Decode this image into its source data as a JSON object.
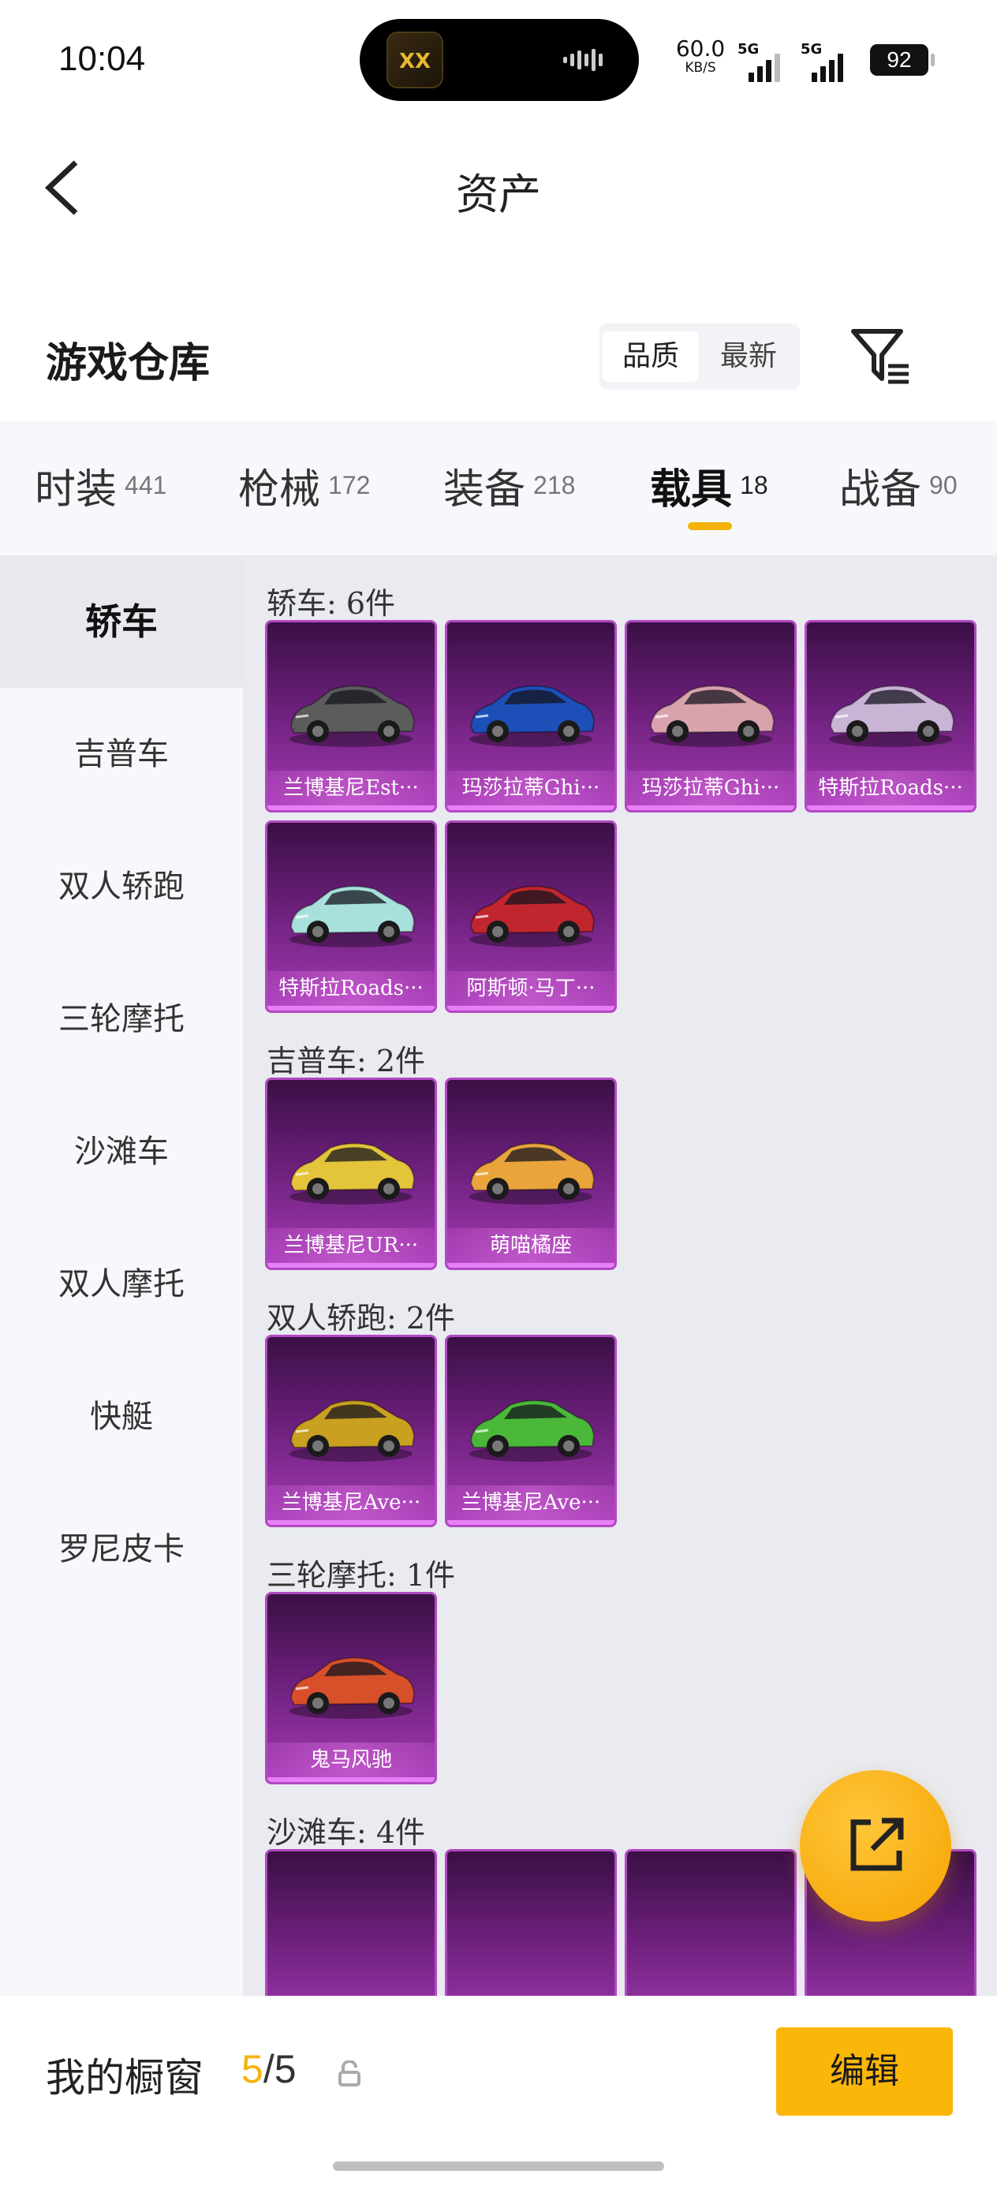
{
  "status_bar": {
    "time": "10:04",
    "island_app": "XX",
    "net_speed_value": "60.0",
    "net_speed_unit": "KB/S",
    "sim1_tag": "5G",
    "sim2_tag": "5G",
    "battery": "92"
  },
  "header": {
    "title": "资产"
  },
  "warehouse": {
    "title": "游戏仓库",
    "sort_options": [
      "品质",
      "最新"
    ],
    "sort_selected": "品质"
  },
  "tabs": [
    {
      "label": "时装",
      "count": "441"
    },
    {
      "label": "枪械",
      "count": "172"
    },
    {
      "label": "装备",
      "count": "218"
    },
    {
      "label": "载具",
      "count": "18"
    },
    {
      "label": "战备",
      "count": "90"
    }
  ],
  "active_tab": "载具",
  "sidebar": {
    "items": [
      "轿车",
      "吉普车",
      "双人轿跑",
      "三轮摩托",
      "沙滩车",
      "双人摩托",
      "快艇",
      "罗尼皮卡"
    ],
    "active": "轿车"
  },
  "sections": [
    {
      "label": "轿车: 6件",
      "items": [
        {
          "name": "兰博基尼Est···",
          "color": "#5c5c5c"
        },
        {
          "name": "玛莎拉蒂Ghi···",
          "color": "#1d4fb8"
        },
        {
          "name": "玛莎拉蒂Ghi···",
          "color": "#d9a3ae"
        },
        {
          "name": "特斯拉Roads···",
          "color": "#c9b4d6"
        },
        {
          "name": "特斯拉Roads···",
          "color": "#a8e0dc"
        },
        {
          "name": "阿斯顿·马丁···",
          "color": "#c1262e"
        }
      ]
    },
    {
      "label": "吉普车: 2件",
      "items": [
        {
          "name": "兰博基尼UR···",
          "color": "#e3c43a"
        },
        {
          "name": "萌喵橘座",
          "color": "#e9a53c"
        }
      ]
    },
    {
      "label": "双人轿跑: 2件",
      "items": [
        {
          "name": "兰博基尼Ave···",
          "color": "#c9a020"
        },
        {
          "name": "兰博基尼Ave···",
          "color": "#4bb83a"
        }
      ]
    },
    {
      "label": "三轮摩托: 1件",
      "items": [
        {
          "name": "鬼马风驰",
          "color": "#d8502a"
        }
      ]
    },
    {
      "label": "沙滩车: 4件",
      "items": [
        {
          "name": "",
          "color": "#6b1f7a"
        },
        {
          "name": "",
          "color": "#6b1f7a"
        },
        {
          "name": "",
          "color": "#6b1f7a"
        },
        {
          "name": "",
          "color": "#6b1f7a"
        }
      ]
    }
  ],
  "showcase": {
    "label": "我的橱窗",
    "current": "5",
    "total": "/5",
    "edit_label": "编辑"
  },
  "icons": {
    "back": "chevron-left-icon",
    "filter": "filter-icon",
    "share": "share-external-icon",
    "lock": "lock-icon"
  }
}
